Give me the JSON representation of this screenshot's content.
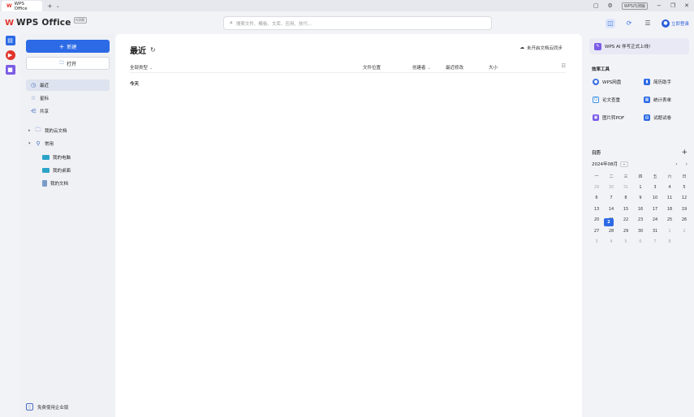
{
  "window": {
    "tab_title": "WPS Office",
    "tab_logo": "W",
    "new_tab": "+",
    "tab_menu": "⌄",
    "badge": "WPS内测版",
    "minimize": "−",
    "restore": "❐",
    "close": "✕"
  },
  "header": {
    "brand_logo": "W",
    "brand_name": "WPS Office",
    "brand_tag": "内测版",
    "search_placeholder": "搜索文件、模板、文库、应用、技巧...",
    "login_label": "立即登录"
  },
  "sidebar": {
    "new_label": "新建",
    "open_label": "打开",
    "nav": [
      {
        "label": "最近",
        "icon": "clock-icon"
      },
      {
        "label": "星标",
        "icon": "star-icon"
      },
      {
        "label": "共享",
        "icon": "share-icon"
      }
    ],
    "cloud_docs": "我的云文档",
    "common": "常用",
    "common_items": [
      "我的电脑",
      "我的桌面",
      "我的文档"
    ],
    "enterprise": "免费使用企业版"
  },
  "main": {
    "title": "最近",
    "cloud_sync": "未开启文档云同步",
    "columns": {
      "type": "全部类型",
      "location": "文件位置",
      "creator": "创建者",
      "modified": "最近修改",
      "size": "大小"
    },
    "group_today": "今天"
  },
  "right_panel": {
    "ai_banner": "WPS AI 伴写正式上线!",
    "tools_title": "效率工具",
    "tools": [
      {
        "label": "WPS网盘",
        "icon": "cloud-disk-icon",
        "color": "#3b72e0"
      },
      {
        "label": "简历助手",
        "icon": "resume-icon",
        "color": "#2c6ae6"
      },
      {
        "label": "论文查重",
        "icon": "paper-check-icon",
        "color": "#3b8fe0"
      },
      {
        "label": "统计表单",
        "icon": "form-icon",
        "color": "#2c6ae6"
      },
      {
        "label": "图片转PDF",
        "icon": "image-pdf-icon",
        "color": "#7b5ce6"
      },
      {
        "label": "试题试卷",
        "icon": "exam-icon",
        "color": "#2c6ae6"
      }
    ],
    "calendar": {
      "title": "日历",
      "add": "+",
      "year_month": "2024年08月",
      "weekdays": [
        "一",
        "二",
        "三",
        "四",
        "五",
        "六",
        "日"
      ],
      "days": [
        [
          "29",
          "30",
          "31",
          "1",
          "2",
          "3",
          "4"
        ],
        [
          "5",
          "6",
          "7",
          "8",
          "9",
          "10",
          "11"
        ],
        [
          "12",
          "13",
          "14",
          "15",
          "16",
          "17",
          "18"
        ],
        [
          "19",
          "20",
          "21",
          "22",
          "23",
          "24",
          "25"
        ],
        [
          "26",
          "27",
          "28",
          "29",
          "30",
          "31",
          "1"
        ],
        [
          "2",
          "3",
          "4",
          "5",
          "6",
          "7",
          "8"
        ]
      ],
      "today": "2"
    }
  },
  "colors": {
    "accent": "#2c6ae6",
    "brand_red": "#e1342b"
  }
}
